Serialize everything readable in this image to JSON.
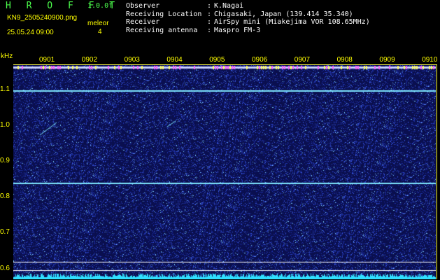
{
  "header": {
    "app_title": "H R O F F T",
    "version": "1.0.0f",
    "filename": "KN9_2505240900.png",
    "datetime": "25.05.24 09:00",
    "mode": "meleor",
    "count": "4",
    "fields": [
      {
        "label": "Observer",
        "value": "K.Nagai"
      },
      {
        "label": "Receiving Location",
        "value": "Chigasaki, Japan (139.414 35.340)"
      },
      {
        "label": "Receiver",
        "value": "AirSpy mini (Miakejima VOR 108.65MHz)"
      },
      {
        "label": "Receiving antenna",
        "value": "Maspro FM-3"
      }
    ]
  },
  "chart_data": {
    "type": "heatmap",
    "ylabel": "kHz",
    "x_ticks": [
      "0901",
      "0902",
      "0903",
      "0904",
      "0905",
      "0906",
      "0907",
      "0908",
      "0909",
      "0910"
    ],
    "y_ticks": [
      "1.1",
      "1.0",
      "0.9",
      "0.8",
      "0.7",
      "0.6"
    ],
    "y_range": [
      0.57,
      1.17
    ],
    "carrier_lines_khz": [
      1.1,
      0.84
    ],
    "reference_lines_khz": [
      0.62,
      0.595
    ],
    "colors": {
      "background": "#0a0f4a",
      "noise": "#3a5cff",
      "line": "#7fe8ff",
      "border": "#ffff44"
    }
  }
}
